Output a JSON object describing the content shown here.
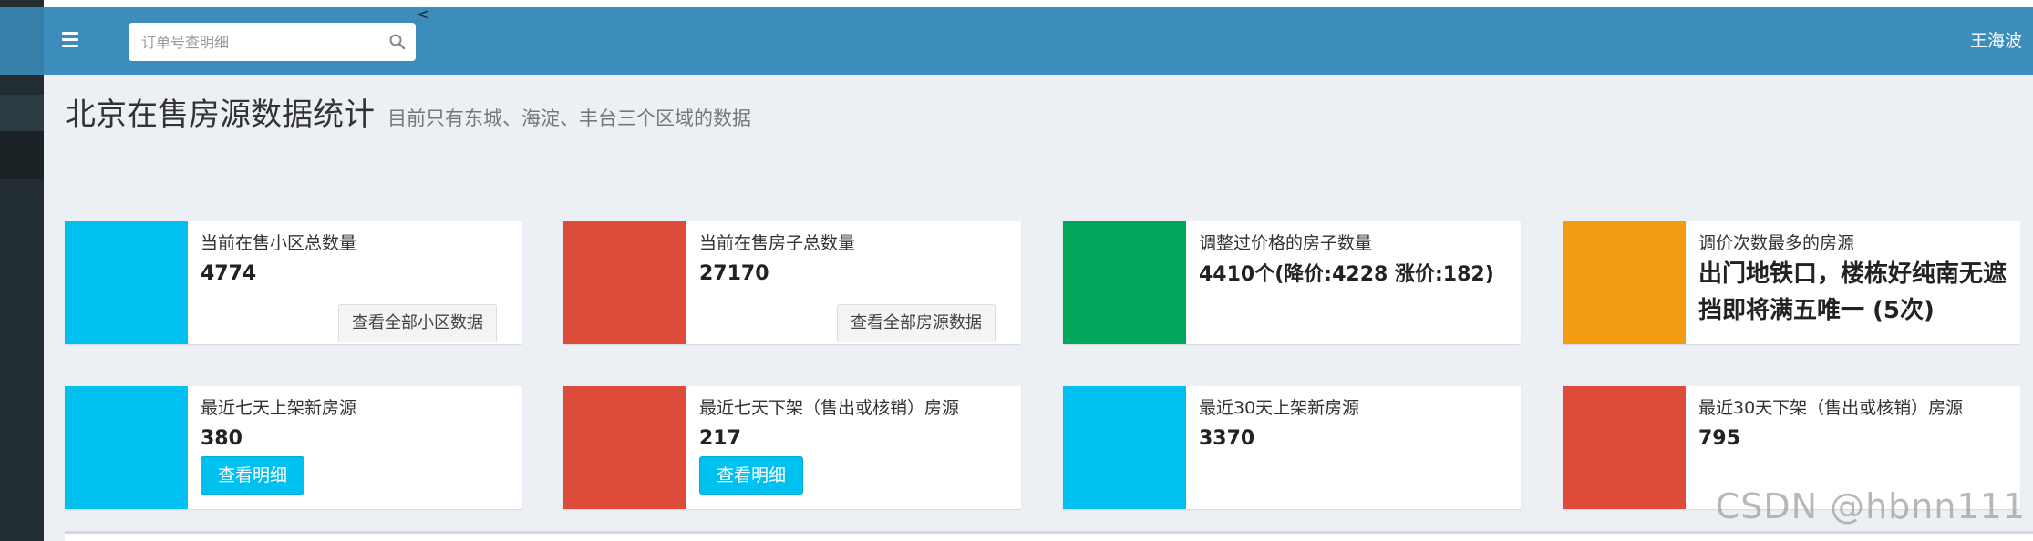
{
  "header": {
    "search": {
      "placeholder": "订单号查明细",
      "value": ""
    },
    "collapse_glyph": "<",
    "user_name": "王海波"
  },
  "page": {
    "title": "北京在售房源数据统计",
    "subtitle": "目前只有东城、海淀、丰台三个区域的数据"
  },
  "colors": {
    "aqua": "#00c0ef",
    "red": "#dd4b39",
    "green": "#00a65a",
    "yellow": "#f39c12",
    "topbar": "#3c8dbc",
    "sidebar": "#222d32"
  },
  "stats_row1": [
    {
      "label": "当前在售小区总数量",
      "value": "4774",
      "color": "aqua",
      "button": "查看全部小区数据"
    },
    {
      "label": "当前在售房子总数量",
      "value": "27170",
      "color": "red",
      "button": "查看全部房源数据"
    },
    {
      "label": "调整过价格的房子数量",
      "value": "4410个(降价:4228 涨价:182)",
      "color": "green"
    },
    {
      "label": "调价次数最多的房源",
      "value": "出门地铁口，楼栋好纯南无遮挡即将满五唯一 (5次)",
      "color": "yellow"
    }
  ],
  "stats_row2": [
    {
      "label": "最近七天上架新房源",
      "value": "380",
      "color": "aqua",
      "button": "查看明细"
    },
    {
      "label": "最近七天下架（售出或核销）房源",
      "value": "217",
      "color": "red",
      "button": "查看明细"
    },
    {
      "label": "最近30天上架新房源",
      "value": "3370",
      "color": "aqua"
    },
    {
      "label": "最近30天下架（售出或核销）房源",
      "value": "795",
      "color": "red"
    }
  ],
  "watermark": "CSDN @hbnn111"
}
